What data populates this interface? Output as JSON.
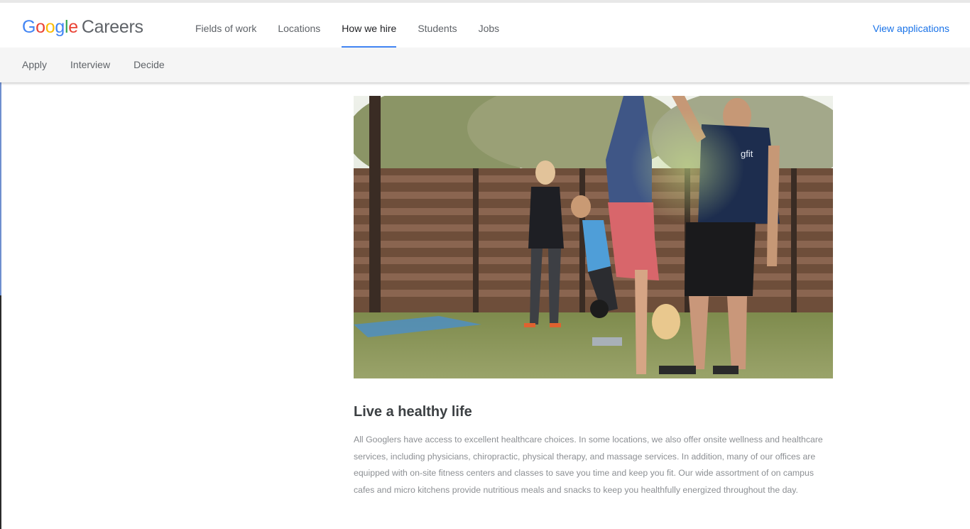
{
  "logo": {
    "g1": "G",
    "o1": "o",
    "o2": "o",
    "g2": "g",
    "l": "l",
    "e": "e",
    "careers": "Careers"
  },
  "nav": {
    "items": [
      "Fields of work",
      "Locations",
      "How we hire",
      "Students",
      "Jobs"
    ],
    "active": "How we hire",
    "view_applications": "View applications"
  },
  "subnav": {
    "items": [
      "Apply",
      "Interview",
      "Decide"
    ]
  },
  "hero": {
    "shirt_text": "gfit"
  },
  "section": {
    "title": "Live a healthy life",
    "body": "All Googlers have access to excellent healthcare choices. In some locations, we also offer onsite wellness and healthcare services, including physicians, chiropractic, physical therapy, and massage services. In addition, many of our offices are equipped with on-site fitness centers and classes to save you time and keep you fit. Our wide assortment of on campus cafes and micro kitchens provide nutritious meals and snacks to keep you healthfully energized throughout the day."
  },
  "colors": {
    "accent": "#4285f4",
    "link": "#1a73e8",
    "subnav_bg": "#f5f5f5"
  }
}
